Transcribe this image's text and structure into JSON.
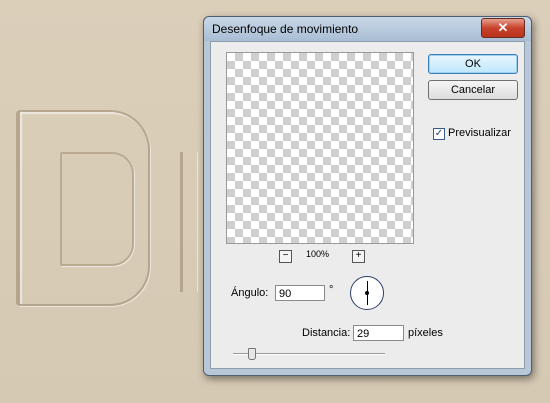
{
  "dialog": {
    "title": "Desenfoque de movimiento",
    "close_label": "✕"
  },
  "buttons": {
    "ok": "OK",
    "cancel": "Cancelar"
  },
  "preview_checkbox": {
    "label": "Previsualizar",
    "checked": true,
    "mark": "✓"
  },
  "zoom": {
    "minus": "−",
    "plus": "+",
    "level": "100%"
  },
  "angle": {
    "label": "Ángulo:",
    "value": "90",
    "unit": "°"
  },
  "distance": {
    "label": "Distancia:",
    "value": "29",
    "unit": "píxeles",
    "slider_fraction": 0.1
  },
  "colors": {
    "title_bar": "#b7c7d8",
    "close_button": "#c7422a",
    "background": "#d7cbb6"
  }
}
